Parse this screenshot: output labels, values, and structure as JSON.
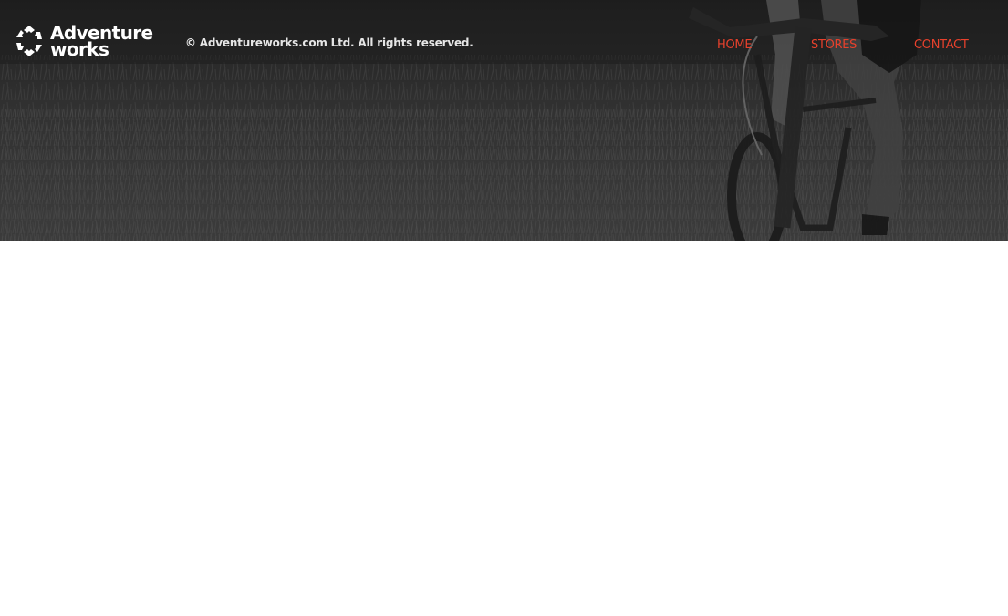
{
  "brand": {
    "name_line1": "Adventure",
    "name_line2": "works",
    "logo_icon": "adventureworks-logo-icon",
    "text_color": "#ffffff"
  },
  "footer": {
    "copyright": "© Adventureworks.com Ltd. All rights reserved.",
    "background_image": "mountain-biker-on-grassy-trail-photo"
  },
  "nav": {
    "items": [
      {
        "label": "HOME"
      },
      {
        "label": "STORES"
      },
      {
        "label": "CONTACT"
      }
    ],
    "link_color": "#e8412c"
  }
}
